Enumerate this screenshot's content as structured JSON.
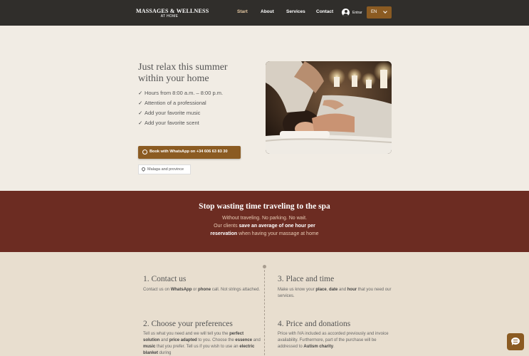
{
  "header": {
    "logo_line1": "MASSAGES & WELLNESS",
    "logo_line2": "AT HOME",
    "nav": [
      {
        "label": "Start",
        "active": true
      },
      {
        "label": "About",
        "active": false
      },
      {
        "label": "Services",
        "active": false
      },
      {
        "label": "Contact",
        "active": false
      }
    ],
    "login_label": "Entrar",
    "language": "EN"
  },
  "hero": {
    "title_line1": "Just relax this summer",
    "title_line2": "within your home",
    "features": [
      "Hours from 8:00 a.m. – 8:00 p.m.",
      "Attention of a professional",
      "Add your favorite music",
      "Add your favorite scent"
    ],
    "check_glyph": "✓",
    "whatsapp_button": "Book with WhatsApp on +34 606 63 83 30",
    "location": "Malaga and province",
    "image_icon": "massage-photo"
  },
  "band": {
    "title": "Stop wasting time traveling to the spa",
    "line1": "Without traveling. No parking. No wait.",
    "line2_prefix": "Our clients ",
    "line2_bold": "save an average of one hour per",
    "line3_bold": "reservation",
    "line3_suffix": " when having your massage at home"
  },
  "steps": [
    {
      "title": "1.  Contact us",
      "text_parts": [
        [
          "Contact us on ",
          false
        ],
        [
          "WhatsApp",
          true
        ],
        [
          " or ",
          false
        ],
        [
          "phone",
          true
        ],
        [
          " call. Not strings attached.",
          false
        ]
      ]
    },
    {
      "title": "3.  Place and time",
      "text_parts": [
        [
          "Make us know your ",
          false
        ],
        [
          "place",
          true
        ],
        [
          ", ",
          false
        ],
        [
          "date",
          true
        ],
        [
          " and ",
          false
        ],
        [
          "hour",
          true
        ],
        [
          " that you need our services.",
          false
        ]
      ]
    },
    {
      "title": "2.  Choose your preferences",
      "text_parts": [
        [
          "Tell us what you need and we will tell you the ",
          false
        ],
        [
          "perfect solution",
          true
        ],
        [
          " and ",
          false
        ],
        [
          "price adapted",
          true
        ],
        [
          " to you. Choose the ",
          false
        ],
        [
          "essence",
          true
        ],
        [
          " and ",
          false
        ],
        [
          "music",
          true
        ],
        [
          " that you prefer. Tell us if you wish to use an ",
          false
        ],
        [
          "electric blanket",
          true
        ],
        [
          " during",
          false
        ]
      ]
    },
    {
      "title": "4.  Price and donations",
      "text_parts": [
        [
          "Price with IVA included as accorded previously and invoice availability. Furthermore, part of the purchase will be addressed to ",
          false
        ],
        [
          "Autism charity",
          true
        ],
        [
          ".",
          false
        ]
      ]
    }
  ],
  "colors": {
    "header_bg": "#302e2b",
    "accent": "#8b5b22",
    "band_bg": "#6c2c22",
    "page_bg": "#f1ece4",
    "steps_bg": "#e8decf"
  }
}
